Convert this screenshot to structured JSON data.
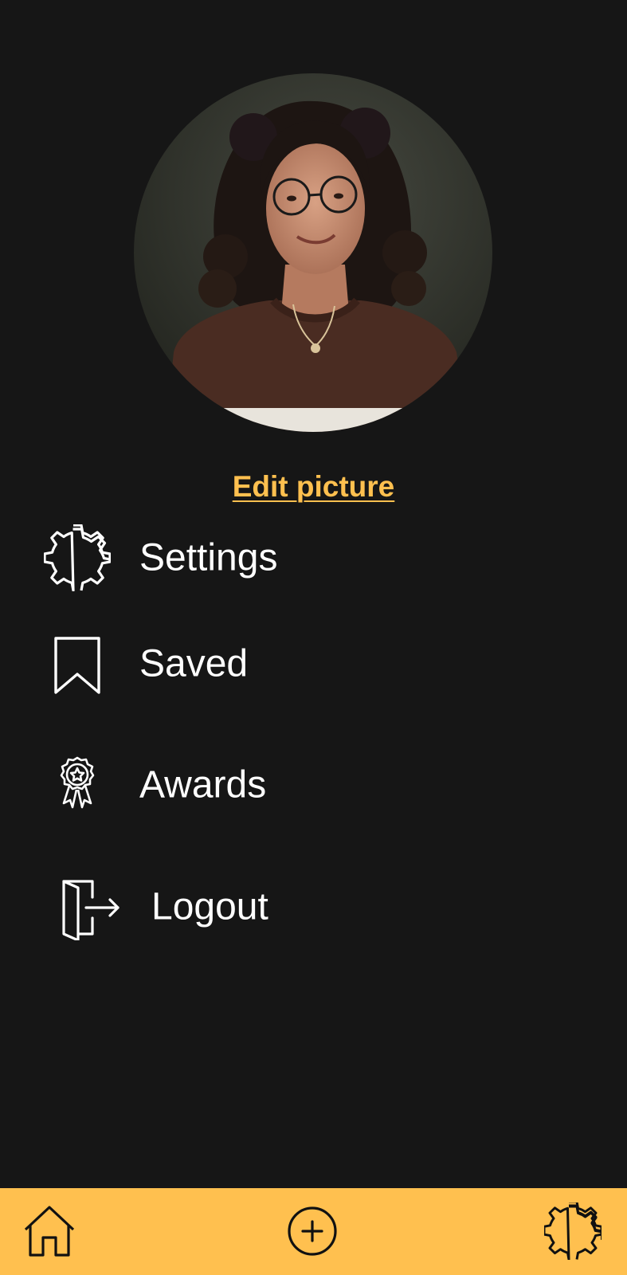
{
  "profile": {
    "edit_picture_label": "Edit picture"
  },
  "menu": {
    "items": [
      {
        "label": "Settings",
        "icon": "gear-icon"
      },
      {
        "label": "Saved",
        "icon": "bookmark-icon"
      },
      {
        "label": "Awards",
        "icon": "award-ribbon-icon"
      },
      {
        "label": "Logout",
        "icon": "logout-icon"
      }
    ]
  },
  "bottom_nav": {
    "items": [
      {
        "icon": "home-icon"
      },
      {
        "icon": "add-circle-icon"
      },
      {
        "icon": "gear-icon"
      }
    ]
  },
  "colors": {
    "background": "#161616",
    "accent": "#ffc04f",
    "text": "#ffffff",
    "nav_icon": "#111111"
  }
}
